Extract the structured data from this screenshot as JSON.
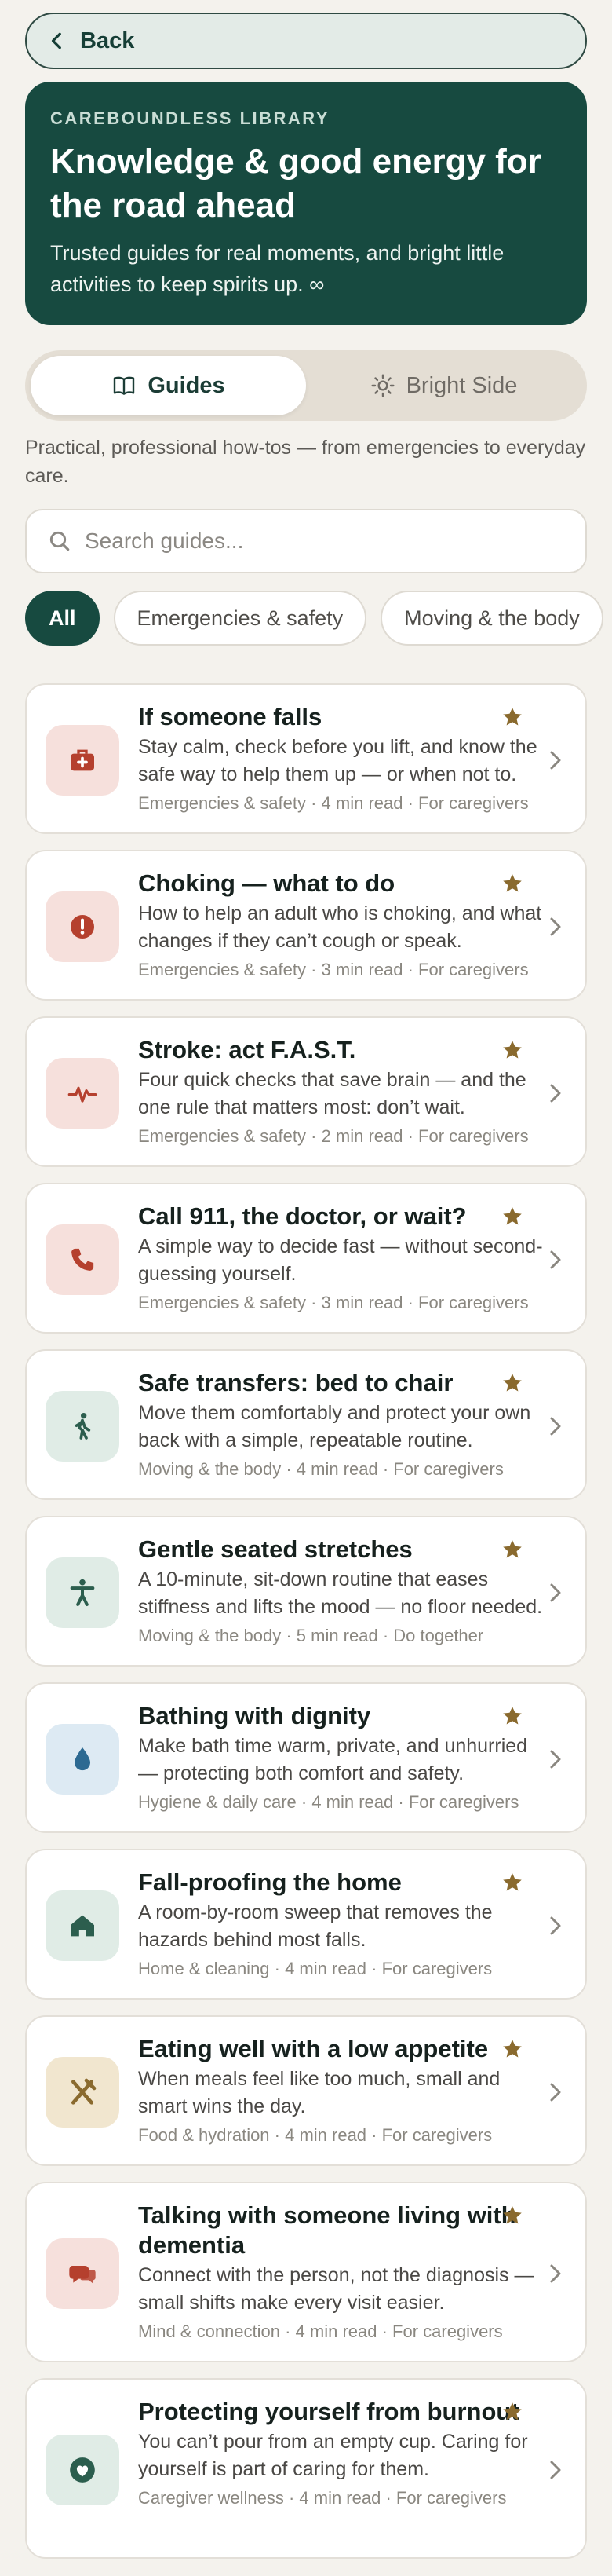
{
  "back": {
    "label": "Back"
  },
  "hero": {
    "eyebrow": "CAREBOUNDLESS LIBRARY",
    "title": "Knowledge & good energy for the road ahead",
    "subtitle": "Trusted guides for real moments, and bright little activities to keep spirits up. ∞"
  },
  "tabs": [
    {
      "label": "Guides",
      "icon": "book-icon",
      "active": true
    },
    {
      "label": "Bright Side",
      "icon": "sun-icon",
      "active": false
    }
  ],
  "intro": "Practical, professional how-tos — from emergencies to everyday care.",
  "search": {
    "placeholder": "Search guides...",
    "value": ""
  },
  "filters": [
    "All",
    "Emergencies & safety",
    "Moving & the body"
  ],
  "colors": {
    "brand": "#174a40",
    "star": "#8a6a2e",
    "red_icon": "#b5402e",
    "green_icon": "#2c5e4e",
    "blue_icon": "#2d6a92"
  },
  "guides": [
    {
      "title": "If someone falls",
      "description": "Stay calm, check before you lift, and know the safe way to help them up — or when not to.",
      "meta": "Emergencies & safety · 4 min read · For caregivers",
      "icon": "first-aid-kit-icon",
      "tone": "red",
      "starred": true
    },
    {
      "title": "Choking — what to do",
      "description": "How to help an adult who is choking, and what changes if they can’t cough or speak.",
      "meta": "Emergencies & safety · 3 min read · For caregivers",
      "icon": "alert-icon",
      "tone": "red",
      "starred": true
    },
    {
      "title": "Stroke: act F.A.S.T.",
      "description": "Four quick checks that save brain — and the one rule that matters most: don’t wait.",
      "meta": "Emergencies & safety · 2 min read · For caregivers",
      "icon": "heartbeat-icon",
      "tone": "red",
      "starred": true
    },
    {
      "title": "Call 911, the doctor, or wait?",
      "description": "A simple way to decide fast — without second-guessing yourself.",
      "meta": "Emergencies & safety · 3 min read · For caregivers",
      "icon": "phone-icon",
      "tone": "red",
      "starred": true
    },
    {
      "title": "Safe transfers: bed to chair",
      "description": "Move them comfortably and protect your own back with a simple, repeatable routine.",
      "meta": "Moving & the body · 4 min read · For caregivers",
      "icon": "walking-icon",
      "tone": "green",
      "starred": true
    },
    {
      "title": "Gentle seated stretches",
      "description": "A 10-minute, sit-down routine that eases stiffness and lifts the mood — no floor needed.",
      "meta": "Moving & the body · 5 min read · Do together",
      "icon": "person-icon",
      "tone": "green",
      "starred": true
    },
    {
      "title": "Bathing with dignity",
      "description": "Make bath time warm, private, and unhurried — protecting both comfort and safety.",
      "meta": "Hygiene & daily care · 4 min read · For caregivers",
      "icon": "water-drop-icon",
      "tone": "blue",
      "starred": true
    },
    {
      "title": "Fall-proofing the home",
      "description": "A room-by-room sweep that removes the hazards behind most falls.",
      "meta": "Home & cleaning · 4 min read · For caregivers",
      "icon": "home-icon",
      "tone": "green",
      "starred": true
    },
    {
      "title": "Eating well with a low appetite",
      "description": "When meals feel like too much, small and smart wins the day.",
      "meta": "Food & hydration · 4 min read · For caregivers",
      "icon": "utensils-icon",
      "tone": "tan",
      "starred": true
    },
    {
      "title": "Talking with someone living with dementia",
      "description": "Connect with the person, not the diagnosis — small shifts make every visit easier.",
      "meta": "Mind & connection · 4 min read · For caregivers",
      "icon": "chat-bubbles-icon",
      "tone": "red",
      "starred": true
    },
    {
      "title": "Protecting yourself from burnout",
      "description": "You can’t pour from an empty cup. Caring for yourself is part of caring for them.",
      "meta": "Caregiver wellness · 4 min read · For caregivers",
      "icon": "heart-shield-icon",
      "tone": "green",
      "starred": true
    }
  ]
}
